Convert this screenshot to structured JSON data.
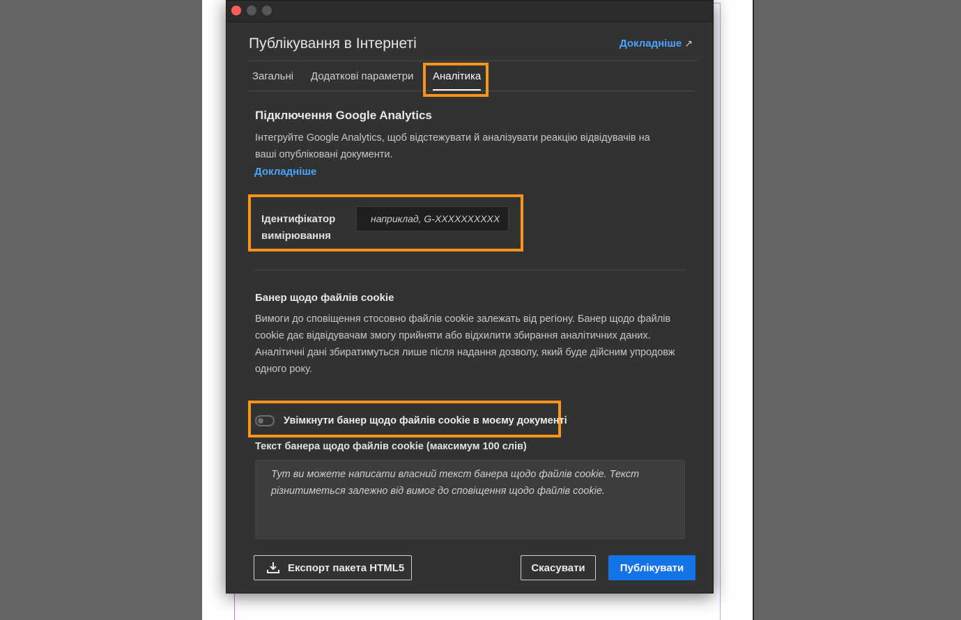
{
  "dialog": {
    "title": "Публікування в Інтернеті",
    "learn_more_top": "Докладніше"
  },
  "tabs": [
    {
      "label": "Загальні"
    },
    {
      "label": "Додаткові параметри"
    },
    {
      "label": "Аналітика",
      "selected": true
    }
  ],
  "analytics": {
    "section_title": "Підключення Google Analytics",
    "description": "Інтегруйте Google Analytics, щоб відстежувати й аналізувати реакцію відвідувачів на ваші опубліковані документи.",
    "learn_more": "Докладніше",
    "measurement_id_label": "Ідентифікатор вимірювання",
    "measurement_id_placeholder": "наприклад, G-XXXXXXXXXX",
    "measurement_id_value": ""
  },
  "cookie": {
    "title": "Банер щодо файлів cookie",
    "description": "Вимоги до сповіщення стосовно файлів cookie залежать від регіону. Банер щодо файлів cookie дає відвідувачам змогу прийняти або відхилити збирання аналітичних даних. Аналітичні дані збиратимуться лише після надання дозволу, який буде дійсним упродовж одного року.",
    "toggle_label": "Увімкнути банер щодо файлів cookie в моєму документі",
    "toggle_on": false,
    "text_label": "Текст банера щодо файлів cookie (максимум 100 слів)",
    "text_placeholder": "Тут ви можете написати власний текст банера щодо файлів cookie. Текст різнитиметься залежно від вимог до сповіщення щодо файлів cookie."
  },
  "buttons": {
    "export": "Експорт пакета HTML5",
    "cancel": "Скасувати",
    "publish": "Публікувати"
  },
  "colors": {
    "accent": "#1473e6",
    "link": "#4aa3ff",
    "highlight": "#f7941d",
    "dialog_bg": "#323232"
  }
}
